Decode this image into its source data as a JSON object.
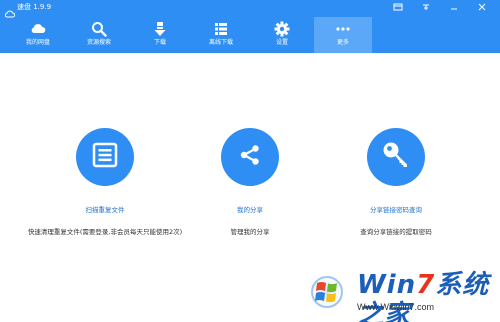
{
  "app": {
    "title": "速盘 1.9.9"
  },
  "window_controls": [
    "menu-icon",
    "restore-icon",
    "minimize-icon",
    "close-icon"
  ],
  "nav": [
    {
      "label": "我的网盘",
      "icon": "cloud-icon",
      "active": false
    },
    {
      "label": "资源搜索",
      "icon": "search-icon",
      "active": false
    },
    {
      "label": "下载",
      "icon": "download-icon",
      "active": false
    },
    {
      "label": "离线下载",
      "icon": "list-icon",
      "active": false
    },
    {
      "label": "设置",
      "icon": "gear-icon",
      "active": false
    },
    {
      "label": "更多",
      "icon": "more-icon",
      "active": true
    }
  ],
  "features": [
    {
      "title": "扫描重复文件",
      "desc": "快速清理重复文件(需要登录,非会员每天只能使用2次)",
      "icon": "document-icon"
    },
    {
      "title": "我的分享",
      "desc": "管理我的分享",
      "icon": "share-icon"
    },
    {
      "title": "分享链接密码查询",
      "desc": "查询分享链接的提取密码",
      "icon": "key-icon"
    }
  ],
  "watermark": {
    "brand_main": "Win",
    "brand_seven": "7",
    "brand_suffix": "系统之家",
    "url": "Www.Winwin7.com"
  },
  "colors": {
    "accent": "#2f8ef4",
    "active_tab": "#5aa8f7",
    "title_link": "#1f6fd0"
  }
}
